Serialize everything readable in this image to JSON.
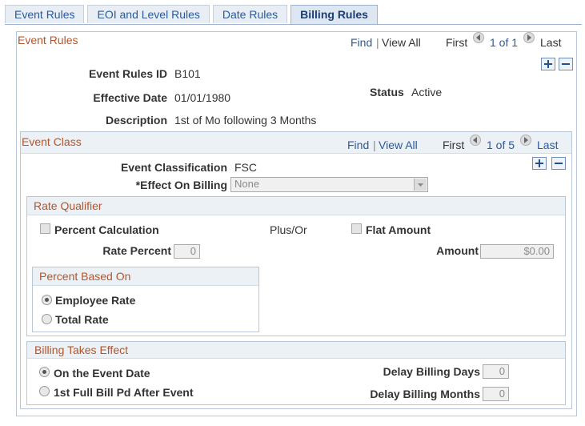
{
  "tabs": [
    {
      "label": "Event Rules"
    },
    {
      "label": "EOI and Level Rules"
    },
    {
      "label": "Date Rules"
    },
    {
      "label": "Billing Rules"
    }
  ],
  "event_rules": {
    "header": "Event Rules",
    "find": "Find",
    "sep": "|",
    "view_all": "View All",
    "first": "First",
    "pager": "1 of 1",
    "last": "Last",
    "id_label": "Event Rules ID",
    "id_value": "B101",
    "effdt_label": "Effective Date",
    "effdt_value": "01/01/1980",
    "status_label": "Status",
    "status_value": "Active",
    "descr_label": "Description",
    "descr_value": "1st of Mo following 3 Months"
  },
  "event_class": {
    "header": "Event Class",
    "find": "Find",
    "sep": "|",
    "view_all": "View All",
    "first": "First",
    "pager": "1 of 5",
    "last": "Last",
    "class_label": "Event Classification",
    "class_value": "FSC",
    "billing_label": "*Effect On Billing",
    "billing_value": "None"
  },
  "rate_qualifier": {
    "header": "Rate Qualifier",
    "percent_calc": "Percent Calculation",
    "plus_or": "Plus/Or",
    "flat_amount": "Flat Amount",
    "rate_percent_label": "Rate Percent",
    "rate_percent_value": "0",
    "amount_label": "Amount",
    "amount_value": "$0.00"
  },
  "percent_based_on": {
    "header": "Percent Based On",
    "employee_rate": "Employee Rate",
    "total_rate": "Total Rate"
  },
  "billing_effect": {
    "header": "Billing Takes Effect",
    "on_event_date": "On the Event Date",
    "first_full_bill": "1st Full Bill Pd After Event",
    "delay_days_label": "Delay Billing Days",
    "delay_days_value": "0",
    "delay_months_label": "Delay Billing Months",
    "delay_months_value": "0"
  },
  "colors": {
    "header_text": "#b4542a",
    "link": "#2a5a9c",
    "border": "#b8c6d6"
  }
}
